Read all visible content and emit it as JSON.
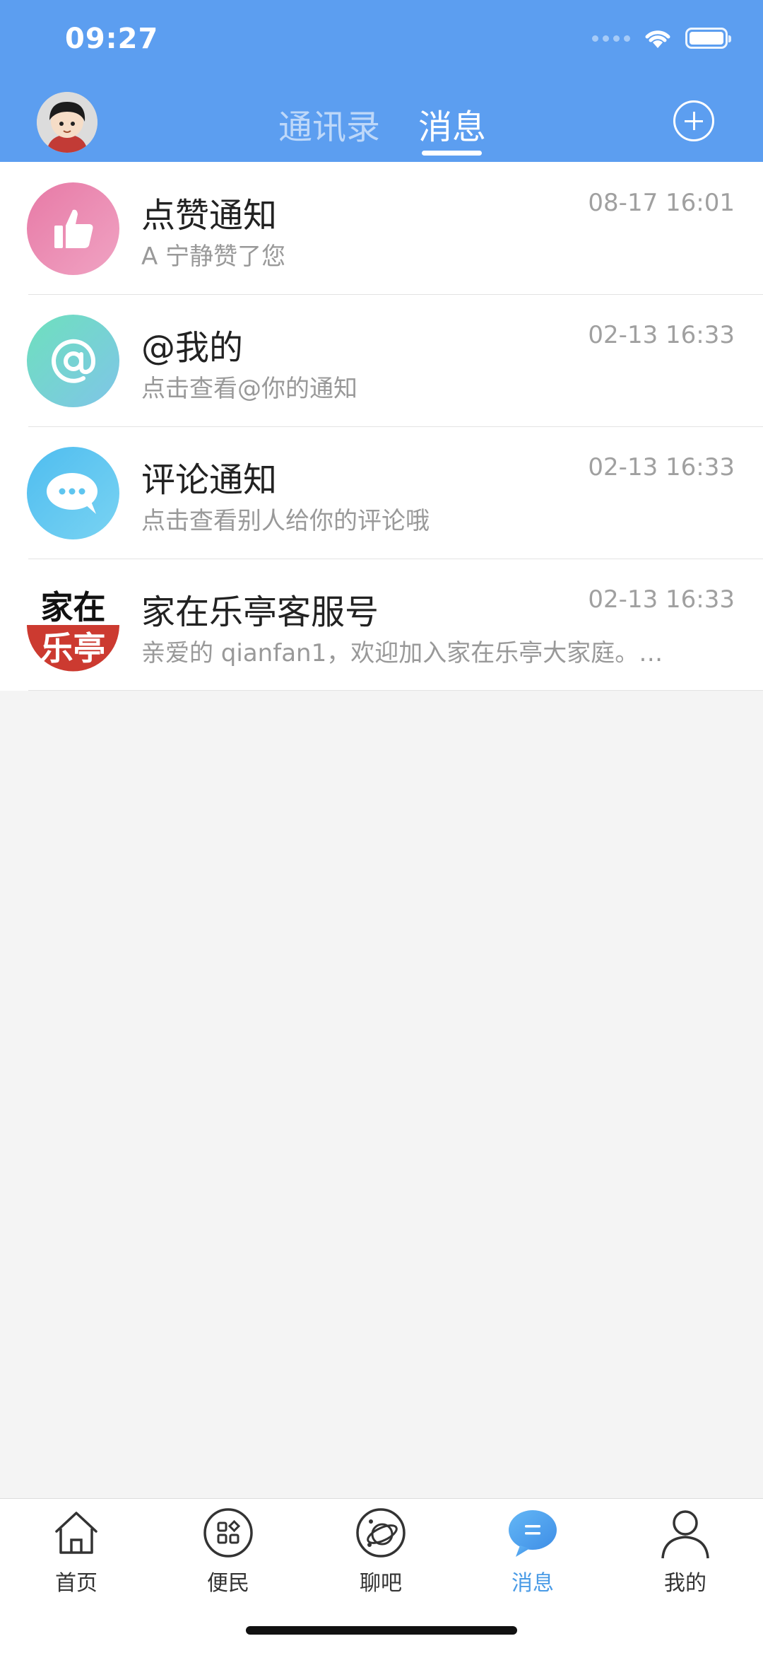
{
  "status_bar": {
    "time": "09:27"
  },
  "header": {
    "tabs": [
      {
        "label": "通讯录",
        "active": false
      },
      {
        "label": "消息",
        "active": true
      }
    ],
    "add_icon": "plus-circle-icon"
  },
  "messages": [
    {
      "title": "点赞通知",
      "subtitle": "A 宁静赞了您",
      "time": "08-17 16:01",
      "icon": "thumbs-up-icon",
      "color": "#e98bb1"
    },
    {
      "title": "@我的",
      "subtitle": "点击查看@你的通知",
      "time": "02-13 16:33",
      "icon": "at-sign-icon",
      "color": "#6fd3c3"
    },
    {
      "title": "评论通知",
      "subtitle": "点击查看别人给你的评论哦",
      "time": "02-13 16:33",
      "icon": "comment-bubble-icon",
      "color": "#5cc4ee"
    },
    {
      "title": "家在乐亭客服号",
      "subtitle": "亲爱的 qianfan1，欢迎加入家在乐亭大家庭。…",
      "time": "02-13 16:33",
      "icon": "brand-logo",
      "logo_text_top": "家在",
      "logo_text_bottom": "乐亭"
    }
  ],
  "tabbar": {
    "items": [
      {
        "label": "首页",
        "icon": "home-icon",
        "active": false
      },
      {
        "label": "便民",
        "icon": "apps-grid-icon",
        "active": false
      },
      {
        "label": "聊吧",
        "icon": "chat-planet-icon",
        "active": false
      },
      {
        "label": "消息",
        "icon": "message-bubble-icon",
        "active": true
      },
      {
        "label": "我的",
        "icon": "user-icon",
        "active": false
      }
    ]
  },
  "colors": {
    "header": "#5c9ef0",
    "active_tab": "#4a9be6",
    "background": "#f4f4f4"
  }
}
